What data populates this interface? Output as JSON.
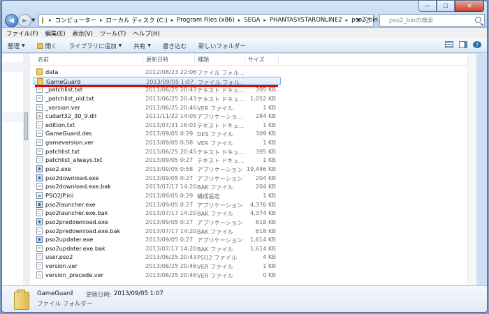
{
  "window": {
    "controls": {
      "minimize": "—",
      "maximize": "☐",
      "close": "✕"
    }
  },
  "nav": {
    "back": "◀",
    "forward": "▶",
    "history": "▼"
  },
  "address": {
    "crumbs": [
      "コンピューター",
      "ローカル ディスク (C:)",
      "Program Files (x86)",
      "SEGA",
      "PHANTASYSTARONLINE2",
      "pso2_bin"
    ],
    "separator": "▸",
    "dropdown": "▼",
    "refresh": "⟳"
  },
  "search": {
    "placeholder": "pso2_binの検索"
  },
  "menu": [
    "ファイル(F)",
    "編集(E)",
    "表示(V)",
    "ツール(T)",
    "ヘルプ(H)"
  ],
  "toolbar": {
    "organize": "整理",
    "open": "開く",
    "library": "ライブラリに追加",
    "share": "共有",
    "burn": "書き込む",
    "new_folder": "新しいフォルダー",
    "dropdown": "▼",
    "help": "?"
  },
  "columns": {
    "name": "名前",
    "date": "更新日時",
    "type": "種類",
    "size": "サイズ"
  },
  "files": [
    {
      "name": "data",
      "date": "2012/08/23 22:06",
      "type": "ファイル フォル...",
      "size": "",
      "icon": "folder-icon"
    },
    {
      "name": "GameGuard",
      "date": "2013/09/05 1:07",
      "type": "ファイル フォル...",
      "size": "",
      "icon": "folder-icon"
    },
    {
      "name": "_patchlist.txt",
      "date": "2013/06/25 20:43",
      "type": "テキスト ドキュ...",
      "size": "395 KB",
      "icon": "text-file-icon"
    },
    {
      "name": "_patchlist_old.txt",
      "date": "2013/06/25 20:43",
      "type": "テキスト ドキュ...",
      "size": "1,052 KB",
      "icon": "text-file-icon"
    },
    {
      "name": "_version.ver",
      "date": "2013/06/25 20:46",
      "type": "VER ファイル",
      "size": "1 KB",
      "icon": "file-icon"
    },
    {
      "name": "cudart32_30_9.dll",
      "date": "2011/11/22 14:05",
      "type": "アプリケーショ...",
      "size": "284 KB",
      "icon": "dll-icon"
    },
    {
      "name": "edition.txt",
      "date": "2013/07/31 16:01",
      "type": "テキスト ドキュ...",
      "size": "1 KB",
      "icon": "text-file-icon"
    },
    {
      "name": "GameGuard.des",
      "date": "2013/09/05 0:29",
      "type": "DES ファイル",
      "size": "309 KB",
      "icon": "file-icon"
    },
    {
      "name": "gameversion.ver",
      "date": "2013/09/05 0:58",
      "type": "VER ファイル",
      "size": "1 KB",
      "icon": "file-icon"
    },
    {
      "name": "patchlist.txt",
      "date": "2013/06/25 20:45",
      "type": "テキスト ドキュ...",
      "size": "395 KB",
      "icon": "text-file-icon"
    },
    {
      "name": "patchlist_always.txt",
      "date": "2013/09/05 0:27",
      "type": "テキスト ドキュ...",
      "size": "1 KB",
      "icon": "text-file-icon"
    },
    {
      "name": "pso2.exe",
      "date": "2013/09/05 0:58",
      "type": "アプリケーション",
      "size": "19,446 KB",
      "icon": "exe-icon"
    },
    {
      "name": "pso2download.exe",
      "date": "2013/09/05 0:27",
      "type": "アプリケーション",
      "size": "204 KB",
      "icon": "exe-icon"
    },
    {
      "name": "pso2download.exe.bak",
      "date": "2013/07/17 14:20",
      "type": "BAK ファイル",
      "size": "204 KB",
      "icon": "file-icon"
    },
    {
      "name": "PSO2JP.ini",
      "date": "2013/09/05 0:29",
      "type": "構成設定",
      "size": "1 KB",
      "icon": "ini-icon"
    },
    {
      "name": "pso2launcher.exe",
      "date": "2013/09/05 0:27",
      "type": "アプリケーション",
      "size": "4,376 KB",
      "icon": "exe-icon"
    },
    {
      "name": "pso2launcher.exe.bak",
      "date": "2013/07/17 14:20",
      "type": "BAK ファイル",
      "size": "4,374 KB",
      "icon": "file-icon"
    },
    {
      "name": "pso2predownload.exe",
      "date": "2013/09/05 0:27",
      "type": "アプリケーション",
      "size": "618 KB",
      "icon": "exe-icon"
    },
    {
      "name": "pso2predownload.exe.bak",
      "date": "2013/07/17 14:20",
      "type": "BAK ファイル",
      "size": "618 KB",
      "icon": "file-icon"
    },
    {
      "name": "pso2updater.exe",
      "date": "2013/09/05 0:27",
      "type": "アプリケーション",
      "size": "1,614 KB",
      "icon": "exe-icon"
    },
    {
      "name": "pso2updater.exe.bak",
      "date": "2013/07/17 14:20",
      "type": "BAK ファイル",
      "size": "1,614 KB",
      "icon": "file-icon"
    },
    {
      "name": "user.pso2",
      "date": "2013/06/25 20:43",
      "type": "PSO2 ファイル",
      "size": "4 KB",
      "icon": "file-icon"
    },
    {
      "name": "version.ver",
      "date": "2013/06/25 20:46",
      "type": "VER ファイル",
      "size": "1 KB",
      "icon": "file-icon"
    },
    {
      "name": "version_precede.ver",
      "date": "2013/06/25 20:46",
      "type": "VER ファイル",
      "size": "0 KB",
      "icon": "file-icon"
    }
  ],
  "selected_index": 1,
  "status": {
    "name": "GameGuard",
    "date_label": "更新日時:",
    "date": "2013/09/05 1:07",
    "type": "ファイル フォルダー"
  },
  "colors": {
    "highlight_underline": "#ee0000",
    "selection": "#d8ebfb"
  }
}
